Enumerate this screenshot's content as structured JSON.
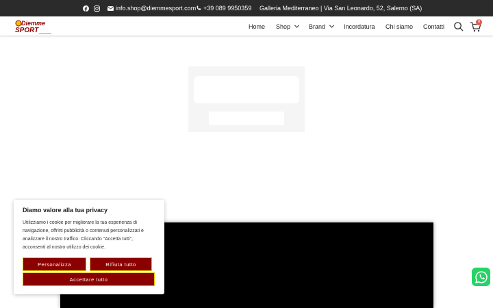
{
  "topbar": {
    "email": "info.shop@diemmesport.com",
    "phone": "+39 089 9950359",
    "address": "Galleria Mediterraneo | Via San Leonardo, 52, Salerno (SA)",
    "icons": [
      "facebook-icon",
      "instagram-icon",
      "envelope-icon",
      "phone-icon"
    ]
  },
  "header": {
    "logo": {
      "line1": "Diemme",
      "line2": "SPORT"
    },
    "nav": [
      {
        "label": "Home"
      },
      {
        "label": "Shop"
      },
      {
        "label": "Brand"
      },
      {
        "label": "Incordatura"
      },
      {
        "label": "Chi siamo"
      },
      {
        "label": "Contatti"
      }
    ],
    "cart_count": "0"
  },
  "cookie": {
    "title": "Diamo valore alla tua privacy",
    "text": "Utilizziamo i cookie per migliorare la tua esperienza di navigazione, offrirti pubblicità o contenuti personalizzati e analizzare il nostro traffico. Cliccando “Accetta tutti”, acconsenti al nostro utilizzo dei cookie.",
    "customize": "Personalizza",
    "reject": "Rifiuta tutto",
    "accept": "Accettare tutto"
  },
  "colors": {
    "topbar_bg": "#2b2b2b",
    "button_bg": "#8b0000",
    "button_border": "#e6c200",
    "whatsapp": "#25d366",
    "badge": "#e25a53"
  }
}
